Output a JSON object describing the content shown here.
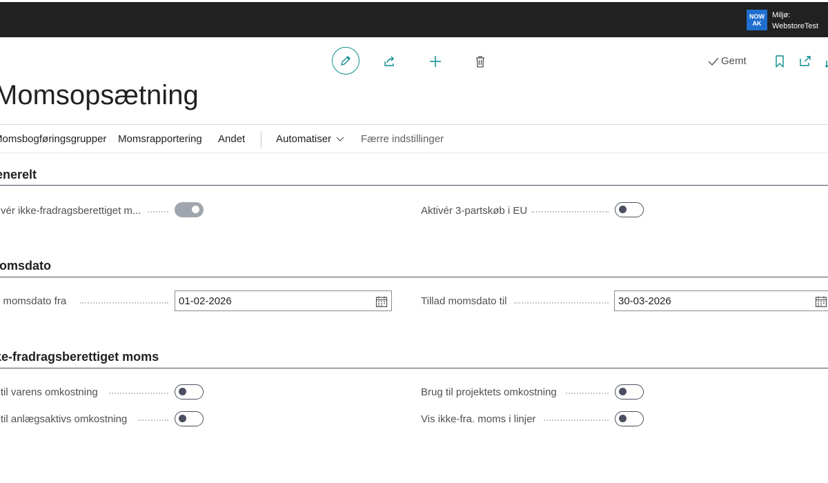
{
  "topbar": {
    "env_badge": [
      "NOW",
      "AK"
    ],
    "env_label_line1": "Miljø:",
    "env_label_line2": "WebstoreTest"
  },
  "actions": {
    "saved_label": "Gemt"
  },
  "page": {
    "title": "Momsopsætning"
  },
  "nav": {
    "items": [
      "Momsbogføringsgrupper",
      "Momsrapportering",
      "Andet"
    ],
    "automate": "Automatiser",
    "fewer": "Færre indstillinger"
  },
  "sections": {
    "general": {
      "title": "Generelt",
      "nondeductible_label": "Aktivér ikke-fradragsberettiget m...",
      "nondeductible_on": true,
      "eu3party_label": "Aktivér 3-partskøb i EU",
      "eu3party_on": false
    },
    "vatdate": {
      "title": "Momsdato",
      "from_label": "Tillad momsdato fra",
      "from_value": "01-02-2026",
      "to_label": "Tillad momsdato til",
      "to_value": "30-03-2026"
    },
    "nondeductible": {
      "title": "Ikke-fradragsberettiget moms",
      "item_cost_label": "Brug til varens omkostning",
      "item_cost_on": false,
      "project_cost_label": "Brug til projektets omkostning",
      "project_cost_on": false,
      "fa_cost_label": "Brug til anlægsaktivs omkostning",
      "fa_cost_on": false,
      "show_lines_label": "Vis ikke-fra. moms i linjer",
      "show_lines_on": false
    }
  },
  "colors": {
    "accent": "#0c8a8c",
    "topbar": "#212121",
    "badge": "#1f6fd0"
  }
}
